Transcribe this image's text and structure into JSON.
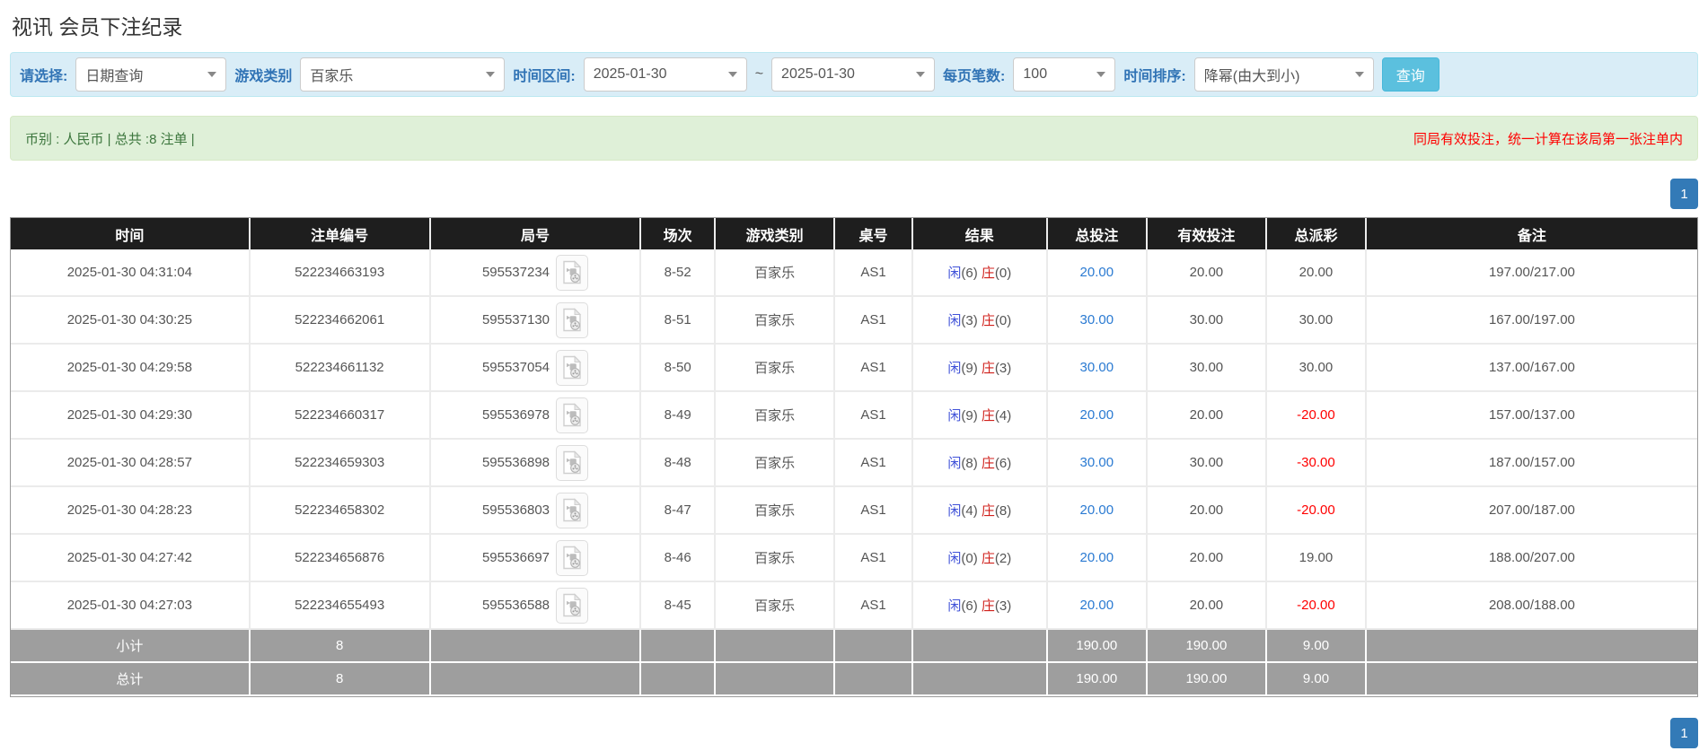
{
  "page": {
    "title": "视讯 会员下注纪录"
  },
  "filters": {
    "select_label": "请选择:",
    "query_type": "日期查询",
    "game_category_label": "游戏类别",
    "game_category": "百家乐",
    "time_range_label": "时间区间:",
    "date_from": "2025-01-30",
    "tilde": "~",
    "date_to": "2025-01-30",
    "page_size_label": "每页笔数:",
    "page_size": "100",
    "sort_label": "时间排序:",
    "sort": "降幂(由大到小)",
    "search_button": "查询"
  },
  "summary_bar": {
    "left": "币别 : 人民币 | 总共 :8 注单 |",
    "right_notice": "同局有效投注，统一计算在该局第一张注单内"
  },
  "pagination": {
    "page": "1"
  },
  "table": {
    "headers": [
      "时间",
      "注单编号",
      "局号",
      "场次",
      "游戏类别",
      "桌号",
      "结果",
      "总投注",
      "有效投注",
      "总派彩",
      "备注"
    ],
    "rows": [
      {
        "time": "2025-01-30 04:31:04",
        "bet_no": "522234663193",
        "round_no": "595537234",
        "session": "8-52",
        "game": "百家乐",
        "table_no": "AS1",
        "result": {
          "player": "闲",
          "player_num": "(6)",
          "banker": "庄",
          "banker_num": "(0)"
        },
        "total_bet": "20.00",
        "valid_bet": "20.00",
        "payout": "20.00",
        "note": "197.00/217.00"
      },
      {
        "time": "2025-01-30 04:30:25",
        "bet_no": "522234662061",
        "round_no": "595537130",
        "session": "8-51",
        "game": "百家乐",
        "table_no": "AS1",
        "result": {
          "player": "闲",
          "player_num": "(3)",
          "banker": "庄",
          "banker_num": "(0)"
        },
        "total_bet": "30.00",
        "valid_bet": "30.00",
        "payout": "30.00",
        "note": "167.00/197.00"
      },
      {
        "time": "2025-01-30 04:29:58",
        "bet_no": "522234661132",
        "round_no": "595537054",
        "session": "8-50",
        "game": "百家乐",
        "table_no": "AS1",
        "result": {
          "player": "闲",
          "player_num": "(9)",
          "banker": "庄",
          "banker_num": "(3)"
        },
        "total_bet": "30.00",
        "valid_bet": "30.00",
        "payout": "30.00",
        "note": "137.00/167.00"
      },
      {
        "time": "2025-01-30 04:29:30",
        "bet_no": "522234660317",
        "round_no": "595536978",
        "session": "8-49",
        "game": "百家乐",
        "table_no": "AS1",
        "result": {
          "player": "闲",
          "player_num": "(9)",
          "banker": "庄",
          "banker_num": "(4)"
        },
        "total_bet": "20.00",
        "valid_bet": "20.00",
        "payout": "-20.00",
        "note": "157.00/137.00"
      },
      {
        "time": "2025-01-30 04:28:57",
        "bet_no": "522234659303",
        "round_no": "595536898",
        "session": "8-48",
        "game": "百家乐",
        "table_no": "AS1",
        "result": {
          "player": "闲",
          "player_num": "(8)",
          "banker": "庄",
          "banker_num": "(6)"
        },
        "total_bet": "30.00",
        "valid_bet": "30.00",
        "payout": "-30.00",
        "note": "187.00/157.00"
      },
      {
        "time": "2025-01-30 04:28:23",
        "bet_no": "522234658302",
        "round_no": "595536803",
        "session": "8-47",
        "game": "百家乐",
        "table_no": "AS1",
        "result": {
          "player": "闲",
          "player_num": "(4)",
          "banker": "庄",
          "banker_num": "(8)"
        },
        "total_bet": "20.00",
        "valid_bet": "20.00",
        "payout": "-20.00",
        "note": "207.00/187.00"
      },
      {
        "time": "2025-01-30 04:27:42",
        "bet_no": "522234656876",
        "round_no": "595536697",
        "session": "8-46",
        "game": "百家乐",
        "table_no": "AS1",
        "result": {
          "player": "闲",
          "player_num": "(0)",
          "banker": "庄",
          "banker_num": "(2)"
        },
        "total_bet": "20.00",
        "valid_bet": "20.00",
        "payout": "19.00",
        "note": "188.00/207.00"
      },
      {
        "time": "2025-01-30 04:27:03",
        "bet_no": "522234655493",
        "round_no": "595536588",
        "session": "8-45",
        "game": "百家乐",
        "table_no": "AS1",
        "result": {
          "player": "闲",
          "player_num": "(6)",
          "banker": "庄",
          "banker_num": "(3)"
        },
        "total_bet": "20.00",
        "valid_bet": "20.00",
        "payout": "-20.00",
        "note": "208.00/188.00"
      }
    ],
    "subtotal": {
      "label": "小计",
      "count": "8",
      "total_bet": "190.00",
      "valid_bet": "190.00",
      "payout": "9.00"
    },
    "total": {
      "label": "总计",
      "count": "8",
      "total_bet": "190.00",
      "valid_bet": "190.00",
      "payout": "9.00"
    }
  },
  "colors": {
    "filter_bg": "#d9edf7",
    "summary_bg": "#dff0d8",
    "summary_text": "#3c763d",
    "notice_red": "#ff0000",
    "header_bg": "#1e1e1e",
    "summary_row_bg": "#9e9e9e",
    "link_blue": "#2a7ad2",
    "player_blue": "#3f51d8",
    "banker_red": "#d0211c",
    "search_btn": "#5bc0de",
    "page_btn": "#337ab7"
  },
  "icons": {
    "video_icon": "video-replay-icon",
    "caret_icon": "chevron-down-icon"
  }
}
